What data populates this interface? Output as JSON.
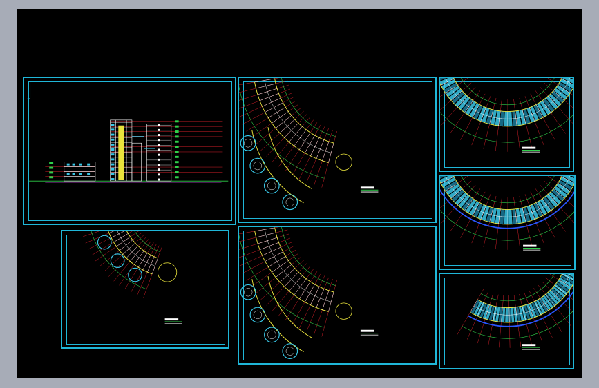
{
  "app": {
    "canvas_background": "#000000",
    "frame_color": "#1fb6d8"
  },
  "palette": {
    "grid_red": "#d8202a",
    "wall_yellow": "#e8e23c",
    "dim_green": "#2fd04a",
    "room_cyan": "#39c8e8",
    "accent_blue": "#2a56ff",
    "magenta": "#c03ad8",
    "white": "#ffffff"
  },
  "sheets": [
    {
      "id": "elevation",
      "kind": "elevation",
      "label": ""
    },
    {
      "id": "plan-site",
      "kind": "plan",
      "label": "",
      "sublabel": ""
    },
    {
      "id": "plan-ground",
      "kind": "plan",
      "label": "",
      "sublabel": ""
    },
    {
      "id": "plan-typical",
      "kind": "plan",
      "label": "",
      "sublabel": ""
    },
    {
      "id": "plan-upper-1",
      "kind": "plan",
      "label": "",
      "sublabel": ""
    },
    {
      "id": "plan-upper-2",
      "kind": "plan",
      "label": "",
      "sublabel": ""
    },
    {
      "id": "plan-upper-3",
      "kind": "plan",
      "label": "",
      "sublabel": ""
    }
  ]
}
